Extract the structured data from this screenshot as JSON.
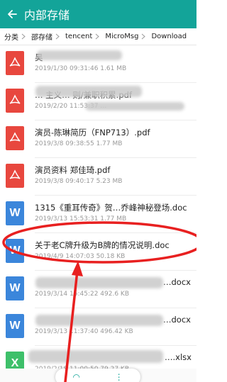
{
  "header": {
    "title": "内部存储",
    "bg_color": "#13a499",
    "back_icon": "arrow-left-icon"
  },
  "breadcrumb": [
    "分类",
    "邵存储",
    "tencent",
    "MicroMsg",
    "Download"
  ],
  "files": [
    {
      "type": "pdf",
      "icon_label": "",
      "name": "昊",
      "meta": "2019/1/30 09:31:46 1.61 MB"
    },
    {
      "type": "pdf",
      "icon_label": "",
      "name": "… 主义… 则/兼职积累.pdf",
      "meta": "2019/2/20 11:53:37 …"
    },
    {
      "type": "pdf",
      "icon_label": "",
      "name": "演员-陈琳简历（FNP713）.pdf",
      "meta": "2019/3/8 09:38:55 1.77 MB"
    },
    {
      "type": "pdf",
      "icon_label": "",
      "name": "演员资料 郑佳琦.pdf",
      "meta": "2019/3/8 09:40:17 5.23 MB"
    },
    {
      "type": "doc",
      "icon_label": "W",
      "name": "1315《重耳传奇》贺…乔峰神秘登场.doc",
      "meta": "2019/3/13 15:53:31 1.77 MB"
    },
    {
      "type": "doc",
      "icon_label": "W",
      "name": "关于老C牌升级为B牌的情况说明.doc",
      "meta": "2019/4/9 14:07:03 50.18 KB"
    },
    {
      "type": "doc",
      "icon_label": "W",
      "name": "…docx",
      "meta": "2019/3/14 15:45:22 492.6 KB"
    },
    {
      "type": "doc",
      "icon_label": "W",
      "name": "…docx",
      "meta": "2019/3/13 11:37:40 496.42 KB"
    },
    {
      "type": "xls",
      "icon_label": "X",
      "name": "….xlsx",
      "meta": "2019/2/18 11:00:50 79.27 KB"
    }
  ],
  "annotation_color": "#e82020"
}
